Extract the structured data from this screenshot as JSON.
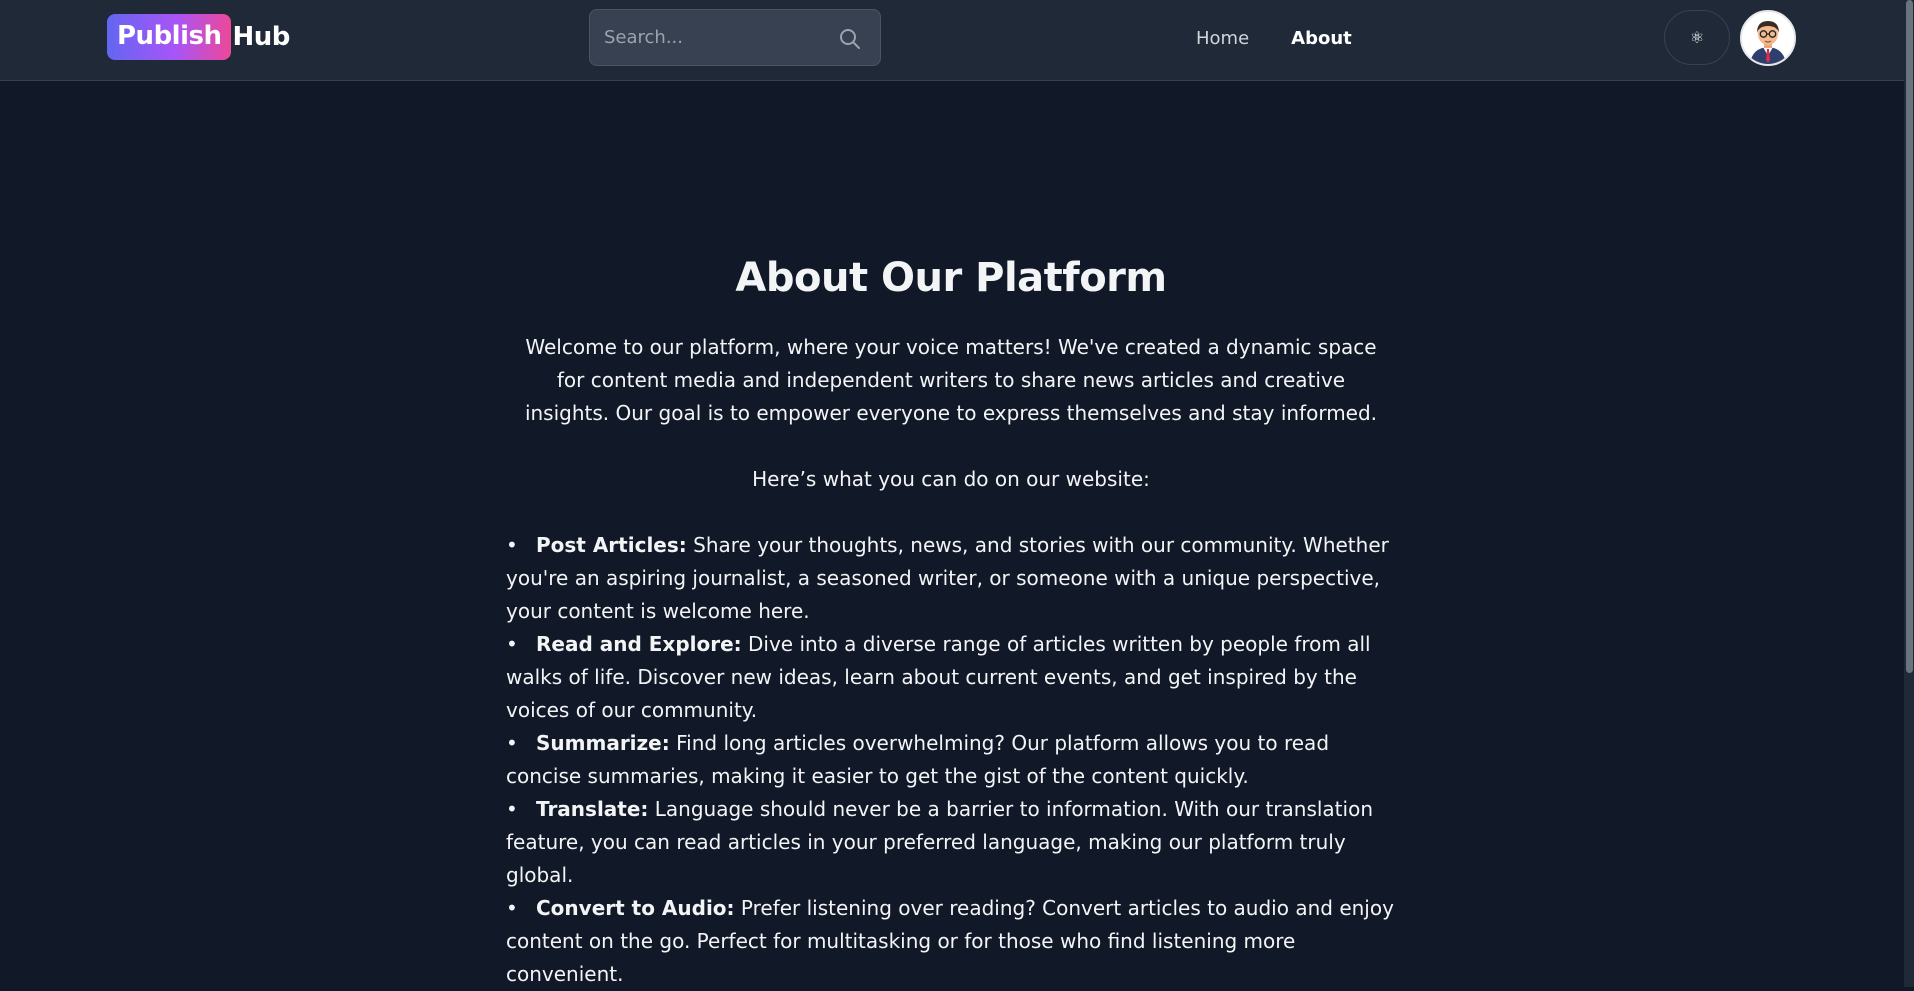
{
  "header": {
    "logo_badge": "Publish",
    "logo_text": "Hub",
    "search_placeholder": "Search...",
    "nav": [
      {
        "label": "Home"
      },
      {
        "label": "About"
      }
    ],
    "theme_icon": "⚛"
  },
  "about": {
    "title": "About Our Platform",
    "intro": "Welcome to our platform, where your voice matters! We've created a dynamic space for content media and independent writers to share news articles and creative insights. Our goal is to empower everyone to express themselves and stay informed.",
    "lead": "Here’s what you can do on our website:",
    "features": [
      {
        "title": "Post Articles:",
        "text": "Share your thoughts, news, and stories with our community. Whether you're an aspiring journalist, a seasoned writer, or someone with a unique perspective, your content is welcome here."
      },
      {
        "title": "Read and Explore:",
        "text": "Dive into a diverse range of articles written by people from all walks of life. Discover new ideas, learn about current events, and get inspired by the voices of our community."
      },
      {
        "title": "Summarize:",
        "text": "Find long articles overwhelming? Our platform allows you to read concise summaries, making it easier to get the gist of the content quickly."
      },
      {
        "title": "Translate:",
        "text": "Language should never be a barrier to information. With our translation feature, you can read articles in your preferred language, making our platform truly global."
      },
      {
        "title": "Convert to Audio:",
        "text": "Prefer listening over reading? Convert articles to audio and enjoy content on the go. Perfect for multitasking or for those who find listening more convenient."
      }
    ]
  },
  "colors": {
    "page_bg": "#111827",
    "navbar_bg": "#1f2937",
    "logo_gradient_start": "#6366f1",
    "logo_gradient_end": "#ec4899"
  }
}
